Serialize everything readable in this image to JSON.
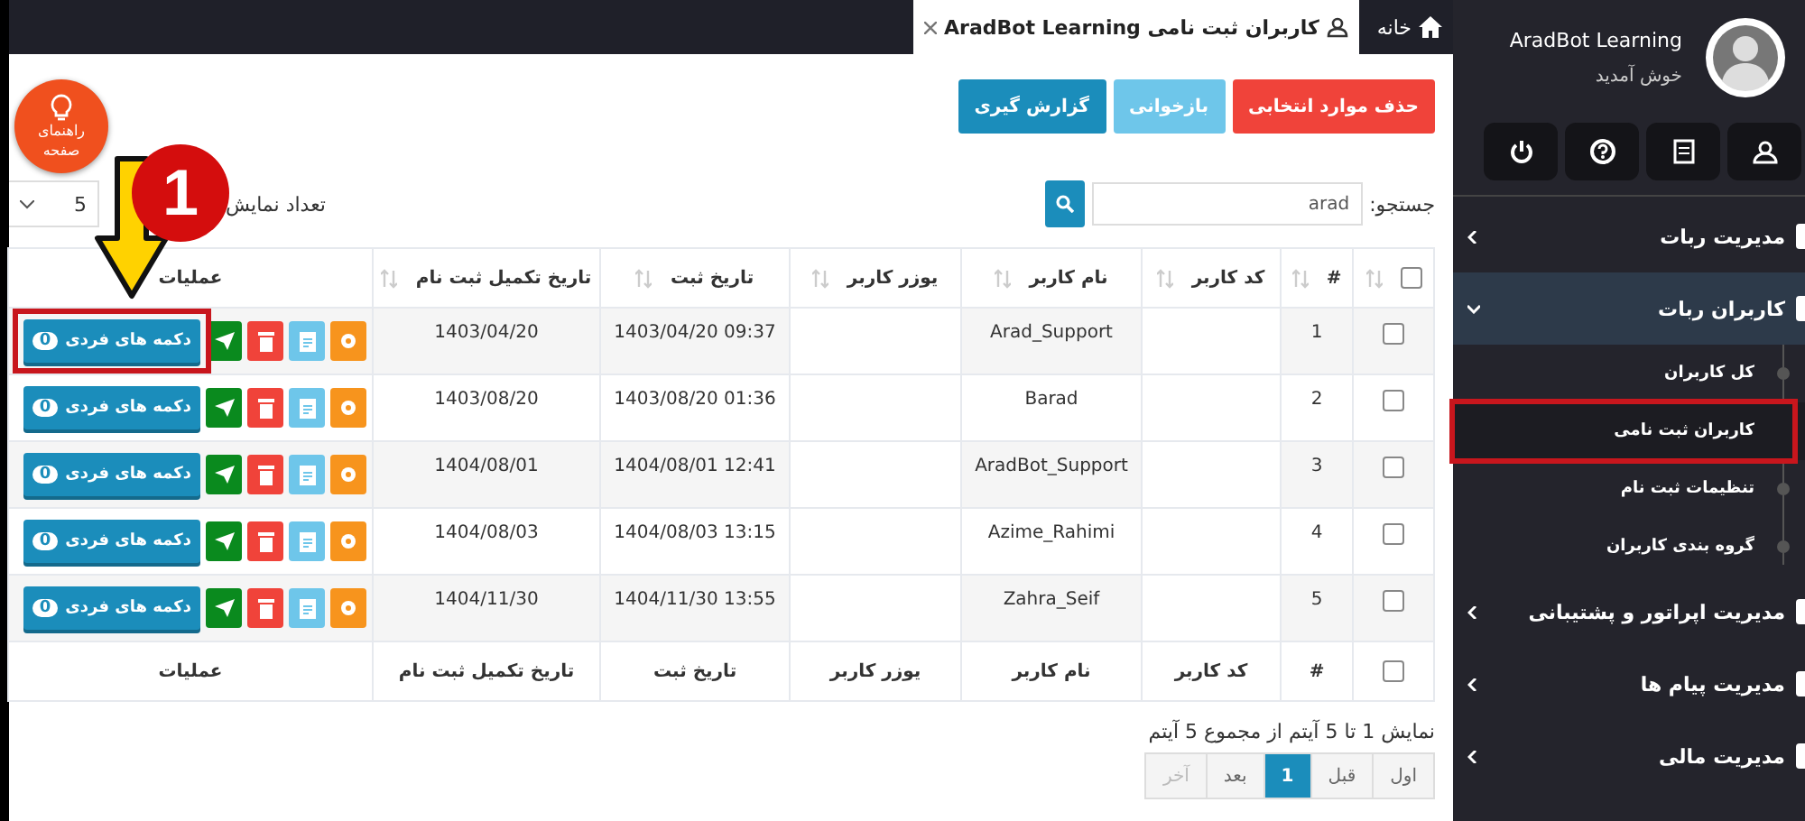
{
  "tabs": [
    {
      "label": "خانه",
      "selected": false,
      "closable": false
    },
    {
      "label": "کاربران ثبت نامی AradBot Learning",
      "selected": true,
      "closable": true
    }
  ],
  "toolbar": [
    {
      "label": "حذف موارد انتخابی",
      "kind": "danger"
    },
    {
      "label": "بازخوانی",
      "kind": "info"
    },
    {
      "label": "گزارش گیری",
      "kind": "primary"
    }
  ],
  "help_button": {
    "lines": [
      "راهنمای",
      "صفحه"
    ]
  },
  "search": {
    "label": "جستجو:",
    "value": "arad"
  },
  "page_size": {
    "label": "تعداد نمایش",
    "value": "5"
  },
  "table": {
    "columns": [
      {
        "kind": "check",
        "sortable": true,
        "checked": false
      },
      {
        "label": "#",
        "sortable": true
      },
      {
        "label": "کد کاربر",
        "sortable": true
      },
      {
        "label": "نام کاربر",
        "sortable": true
      },
      {
        "label": "یوزر کاربر",
        "sortable": true
      },
      {
        "label": "تاریخ ثبت",
        "sortable": true
      },
      {
        "label": "تاریخ تکمیل ثبت نام",
        "sortable": true
      },
      {
        "label": "عملیات",
        "sortable": false
      }
    ],
    "rows": [
      {
        "checked": false,
        "index": "1",
        "username": "Arad_Support",
        "registered": "09:37 1403/04/20",
        "completed": "1403/04/20",
        "action": {
          "label": "دکمه های فردی",
          "count": "0"
        },
        "highlighted": true
      },
      {
        "checked": false,
        "index": "2",
        "username": "Barad",
        "registered": "01:36 1403/08/20",
        "completed": "1403/08/20",
        "action": {
          "label": "دکمه های فردی",
          "count": "0"
        },
        "highlighted": false
      },
      {
        "checked": false,
        "index": "3",
        "username": "AradBot_Support",
        "registered": "12:41 1404/08/01",
        "completed": "1404/08/01",
        "action": {
          "label": "دکمه های فردی",
          "count": "0"
        },
        "highlighted": false
      },
      {
        "checked": false,
        "index": "4",
        "username": "Azime_Rahimi",
        "registered": "13:15 1404/08/03",
        "completed": "1404/08/03",
        "action": {
          "label": "دکمه های فردی",
          "count": "0"
        },
        "highlighted": false
      },
      {
        "checked": false,
        "index": "5",
        "username": "Zahra_Seif",
        "registered": "13:55 1404/11/30",
        "completed": "1404/11/30",
        "action": {
          "label": "دکمه های فردی",
          "count": "0"
        },
        "highlighted": false
      }
    ],
    "footer": [
      {
        "kind": "check",
        "checked": false
      },
      {
        "label": "#"
      },
      {
        "label": "کد کاربر"
      },
      {
        "label": "نام کاربر"
      },
      {
        "label": "یوزر کاربر"
      },
      {
        "label": "تاریخ ثبت"
      },
      {
        "label": "تاریخ تکمیل ثبت نام"
      },
      {
        "label": "عملیات"
      }
    ]
  },
  "pagination": {
    "summary": "نمایش 1 تا 5 آیتم از مجموع 5 آیتم",
    "pages": [
      {
        "label": "اول",
        "selected": false,
        "disabled": false
      },
      {
        "label": "قبل",
        "selected": false,
        "disabled": false
      },
      {
        "label": "1",
        "selected": true,
        "disabled": false
      },
      {
        "label": "بعد",
        "selected": false,
        "disabled": false
      },
      {
        "label": "آخر",
        "selected": false,
        "disabled": true
      }
    ]
  },
  "sidebar": {
    "user": {
      "name": "AradBot Learning",
      "greeting": "خوش آمدید"
    },
    "menu": [
      {
        "label": "مدیریت ربات",
        "expanded": false
      },
      {
        "label": "کاربران ربات",
        "expanded": true,
        "children": [
          {
            "label": "کل کاربران",
            "selected": false,
            "highlighted": false
          },
          {
            "label": "کاربران ثبت نامی",
            "selected": true,
            "highlighted": true
          },
          {
            "label": "تنظیمات ثبت نام",
            "selected": false,
            "highlighted": false
          },
          {
            "label": "گروه بندی کاربران",
            "selected": false,
            "highlighted": false
          }
        ]
      },
      {
        "label": "مدیریت اپراتور و پشتیبانی",
        "expanded": false
      },
      {
        "label": "مدیریت پیام ها",
        "expanded": false
      },
      {
        "label": "مدیریت مالی",
        "expanded": false
      }
    ]
  },
  "annotation": {
    "step": "1"
  }
}
